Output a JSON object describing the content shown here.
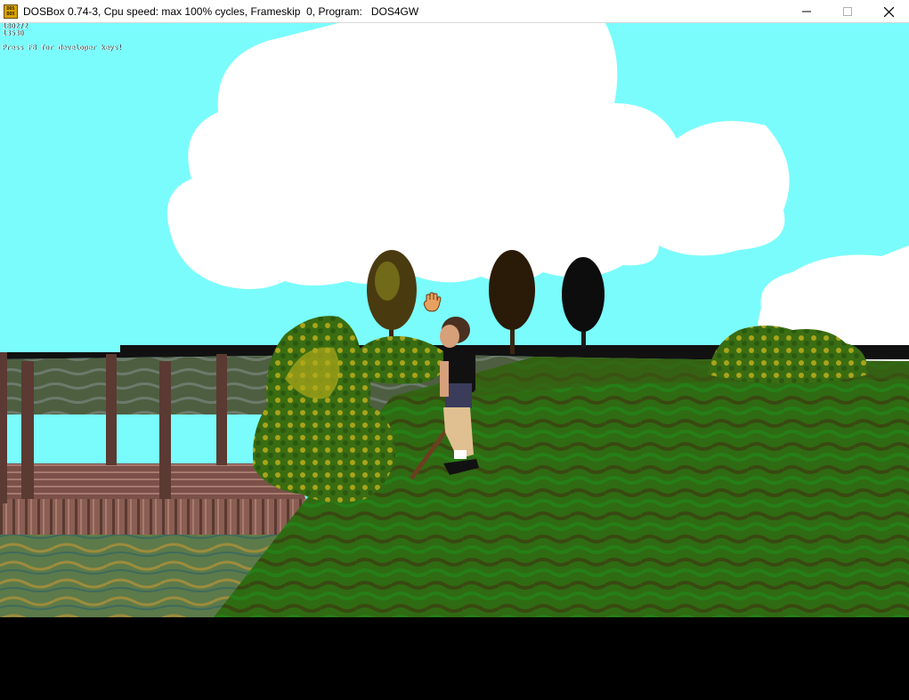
{
  "window": {
    "icon_text": "DOS BOX",
    "title": "DOSBox 0.74-3, Cpu speed: max 100% cycles, Frameskip  0, Program:   DOS4GW",
    "controls": [
      "minimize",
      "maximize",
      "close"
    ]
  },
  "hud": {
    "line1": "180272",
    "line2": "13530",
    "hint": "Press F8 for developer keys!"
  },
  "scene": {
    "sky_color": "#7afcfc",
    "cloud_color": "#ffffff",
    "grass_color": "#2f6b12",
    "water_color": "#5c7a4a",
    "dock_color": "#8a5e52",
    "cursor_icon": "hand-cursor-icon",
    "objects": [
      "clouds",
      "trees",
      "dock",
      "water",
      "grass-field",
      "bushes",
      "player-character",
      "walking-stick"
    ]
  }
}
